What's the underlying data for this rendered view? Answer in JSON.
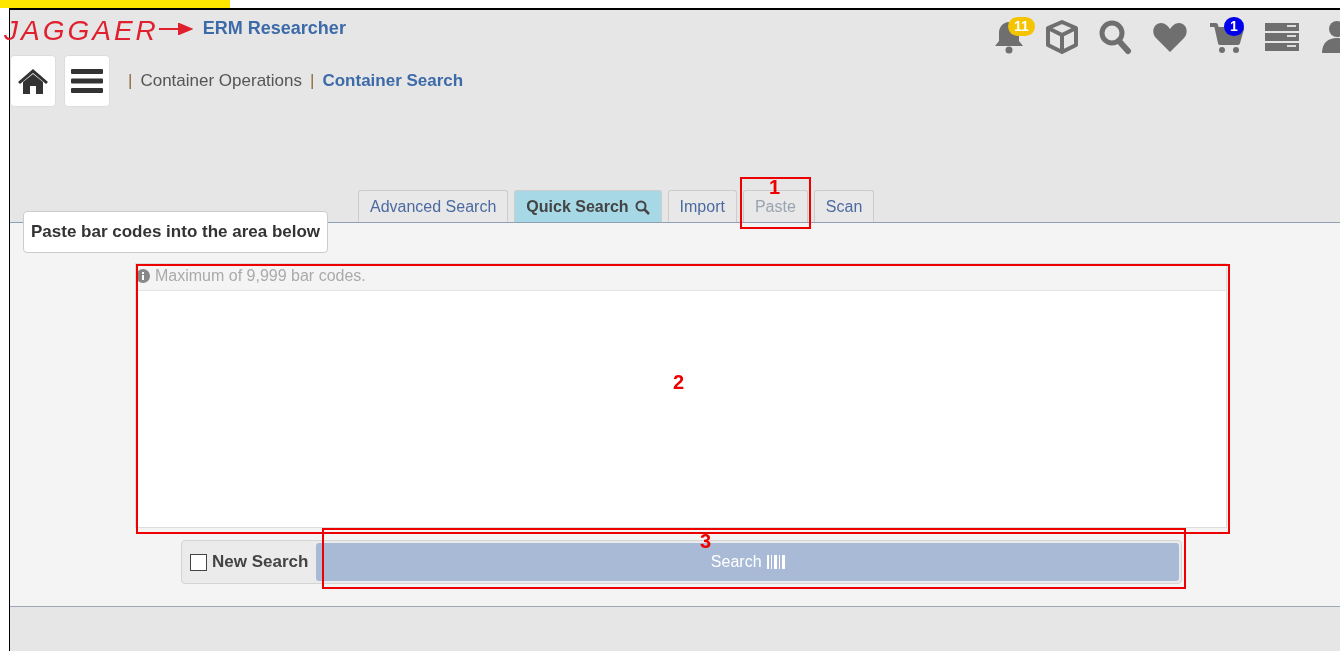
{
  "app": {
    "logo": "JAGGAER",
    "title": "ERM Researcher"
  },
  "toolbar": [
    {
      "kind": "bell",
      "badge": "11",
      "color": "#f5c400"
    },
    {
      "kind": "cube"
    },
    {
      "kind": "search"
    },
    {
      "kind": "heart"
    },
    {
      "kind": "cart",
      "badge": "1",
      "color": "#0000ee"
    },
    {
      "kind": "server"
    },
    {
      "kind": "user"
    }
  ],
  "breadcrumb": [
    {
      "separator": "|",
      "label": "Container Operations",
      "selected": false
    },
    {
      "separator": "|",
      "label": "Container Search",
      "selected": true
    }
  ],
  "tabs": [
    {
      "label": "Advanced Search",
      "selected": false,
      "disabled": false,
      "icon": false
    },
    {
      "label": "Quick Search",
      "selected": true,
      "disabled": false,
      "icon": true
    },
    {
      "label": "Import",
      "selected": false,
      "disabled": false,
      "icon": false
    },
    {
      "label": "Paste",
      "selected": false,
      "disabled": true,
      "icon": false
    },
    {
      "label": "Scan",
      "selected": false,
      "disabled": false,
      "icon": false
    }
  ],
  "panel": {
    "heading": "Paste bar codes into the area below",
    "hint": "Maximum of 9,999 bar codes."
  },
  "new_search": {
    "label": "New Search",
    "checked": false
  },
  "search_button": {
    "label": "Search"
  },
  "annotations": [
    {
      "label": "1"
    },
    {
      "label": "2"
    },
    {
      "label": "3"
    }
  ]
}
